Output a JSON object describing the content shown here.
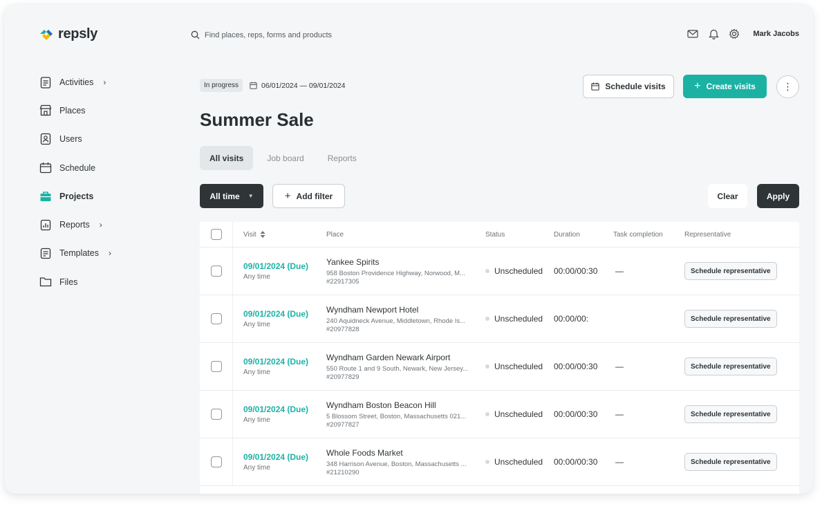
{
  "app": {
    "logo_text": "repsly",
    "search_placeholder": "Find places, reps, forms and products",
    "user_name": "Mark Jacobs"
  },
  "sidebar": {
    "items": [
      {
        "label": "Activities",
        "icon": "clipboard-icon",
        "has_chevron": true
      },
      {
        "label": "Places",
        "icon": "store-icon",
        "has_chevron": false
      },
      {
        "label": "Users",
        "icon": "user-badge-icon",
        "has_chevron": false
      },
      {
        "label": "Schedule",
        "icon": "calendar-icon",
        "has_chevron": false
      },
      {
        "label": "Projects",
        "icon": "briefcase-icon",
        "has_chevron": false,
        "active": true
      },
      {
        "label": "Reports",
        "icon": "bar-chart-icon",
        "has_chevron": true
      },
      {
        "label": "Templates",
        "icon": "template-icon",
        "has_chevron": true
      },
      {
        "label": "Files",
        "icon": "folder-icon",
        "has_chevron": false
      }
    ]
  },
  "project": {
    "status_badge": "In progress",
    "date_range": "06/01/2024 — 09/01/2024",
    "title": "Summer Sale"
  },
  "actions": {
    "schedule_visits": "Schedule visits",
    "create_visits": "Create visits"
  },
  "tabs": [
    {
      "label": "All visits",
      "active": true
    },
    {
      "label": "Job board",
      "active": false
    },
    {
      "label": "Reports",
      "active": false
    }
  ],
  "filters": {
    "time": "All time",
    "add_filter": "Add filter",
    "clear": "Clear",
    "apply": "Apply"
  },
  "table": {
    "headers": {
      "visit": "Visit",
      "place": "Place",
      "status": "Status",
      "duration": "Duration",
      "task": "Task completion",
      "rep": "Representative"
    },
    "rows": [
      {
        "date": "09/01/2024 (Due)",
        "time": "Any time",
        "place": "Yankee Spirits",
        "address": "958 Boston Providence Highway, Norwood, M...",
        "id": "#22917305",
        "status": "Unscheduled",
        "duration": "00:00/00:30",
        "task": "—",
        "rep": "Schedule representative"
      },
      {
        "date": "09/01/2024 (Due)",
        "time": "Any time",
        "place": "Wyndham Newport Hotel",
        "address": "240 Aquidneck Avenue, Middletown, Rhode Is...",
        "id": "#20977828",
        "status": "Unscheduled",
        "duration": "00:00/00:",
        "task": "",
        "rep": "Schedule representative"
      },
      {
        "date": "09/01/2024 (Due)",
        "time": "Any time",
        "place": "Wyndham Garden Newark Airport",
        "address": "550 Route 1 and 9 South, Newark, New Jersey...",
        "id": "#20977829",
        "status": "Unscheduled",
        "duration": "00:00/00:30",
        "task": "—",
        "rep": "Schedule representative"
      },
      {
        "date": "09/01/2024 (Due)",
        "time": "Any time",
        "place": "Wyndham Boston Beacon Hill",
        "address": "5 Blossom Street, Boston, Massachusetts 021...",
        "id": "#20977827",
        "status": "Unscheduled",
        "duration": "00:00/00:30",
        "task": "—",
        "rep": "Schedule representative"
      },
      {
        "date": "09/01/2024 (Due)",
        "time": "Any time",
        "place": "Whole Foods Market",
        "address": "348 Harrison Avenue, Boston, Massachusetts ...",
        "id": "#21210290",
        "status": "Unscheduled",
        "duration": "00:00/00:30",
        "task": "—",
        "rep": "Schedule representative"
      }
    ]
  },
  "colors": {
    "accent": "#1bb2a4",
    "dark": "#2f3437",
    "background": "#f4f6f7"
  }
}
